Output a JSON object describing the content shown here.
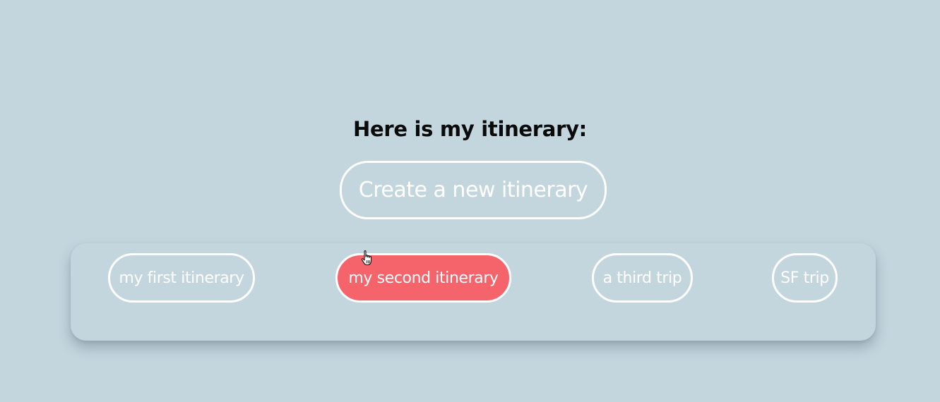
{
  "page": {
    "heading": "Here is my itinerary:",
    "create_button_label": "Create a new itinerary"
  },
  "itineraries": [
    {
      "label": "my first itinerary",
      "selected": false
    },
    {
      "label": "my second itinerary",
      "selected": true
    },
    {
      "label": "a third trip",
      "selected": false
    },
    {
      "label": "SF trip",
      "selected": false
    }
  ],
  "icons": {
    "cursor": "hand-pointer-icon"
  },
  "colors": {
    "background": "#c3d6de",
    "selected_pill": "#f5636b",
    "outline": "#ffffff",
    "heading_text": "#0a0a0a"
  }
}
